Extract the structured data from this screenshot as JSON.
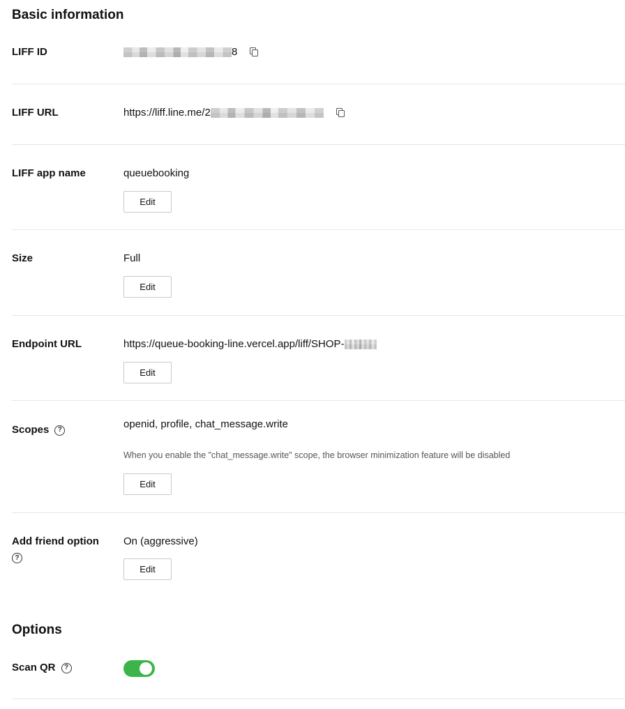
{
  "basic": {
    "title": "Basic information",
    "liff_id": {
      "label": "LIFF ID",
      "value_suffix": "8"
    },
    "liff_url": {
      "label": "LIFF URL",
      "value_prefix": "https://liff.line.me/2"
    },
    "app_name": {
      "label": "LIFF app name",
      "value": "queuebooking",
      "edit_label": "Edit"
    },
    "size": {
      "label": "Size",
      "value": "Full",
      "edit_label": "Edit"
    },
    "endpoint": {
      "label": "Endpoint URL",
      "value_prefix": "https://queue-booking-line.vercel.app/liff/SHOP-",
      "edit_label": "Edit"
    },
    "scopes": {
      "label": "Scopes",
      "value": "openid, profile, chat_message.write",
      "note": "When you enable the \"chat_message.write\" scope, the browser minimization feature will be disabled",
      "edit_label": "Edit"
    },
    "add_friend": {
      "label": "Add friend option",
      "value": "On (aggressive)",
      "edit_label": "Edit"
    }
  },
  "options": {
    "title": "Options",
    "scan_qr": {
      "label": "Scan QR",
      "enabled": true
    }
  },
  "icons": {
    "help": "question-circle-icon",
    "copy": "copy-icon"
  },
  "colors": {
    "toggle_on": "#3bb54a",
    "divider": "#e6e6e6",
    "button_border": "#c9c9c9"
  }
}
